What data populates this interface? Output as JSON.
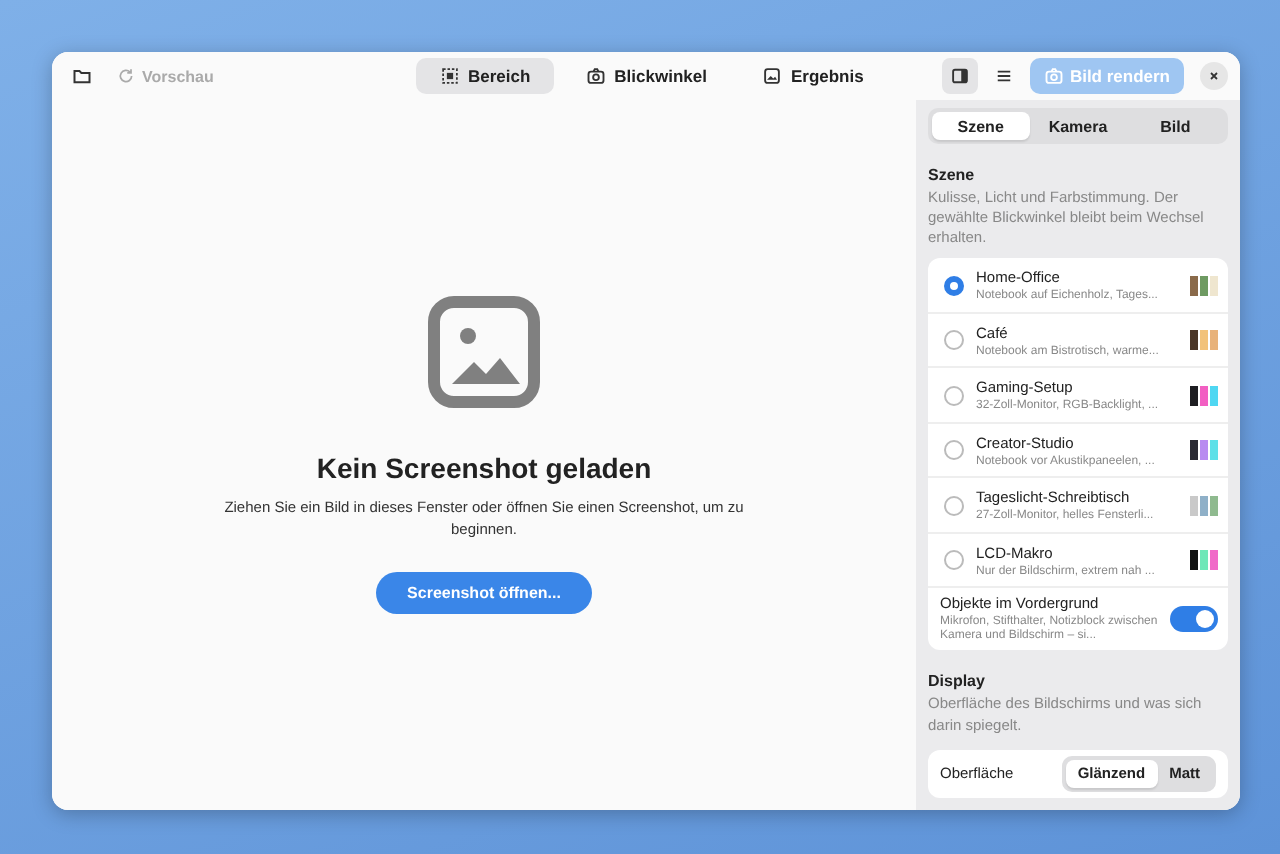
{
  "toolbar": {
    "preview": {
      "label": "Vorschau",
      "disabled": true
    },
    "tabs": [
      {
        "label": "Bereich",
        "selected": true
      },
      {
        "label": "Blickwinkel",
        "selected": false
      },
      {
        "label": "Ergebnis",
        "selected": false
      }
    ],
    "sidebar_toggle": {
      "on": true
    },
    "render_button": {
      "label": "Bild rendern",
      "disabled": true
    }
  },
  "empty_state": {
    "title": "Kein Screenshot geladen",
    "text": "Ziehen Sie ein Bild in dieses Fenster oder öffnen Sie einen Screenshot, um zu beginnen.",
    "button": "Screenshot öffnen..."
  },
  "sidebar": {
    "tabs": [
      {
        "label": "Szene",
        "selected": true
      },
      {
        "label": "Kamera",
        "selected": false
      },
      {
        "label": "Bild",
        "selected": false
      }
    ],
    "scene": {
      "heading": "Szene",
      "description": "Kulisse, Licht und Farbstimmung. Der gewählte Blickwinkel bleibt beim Wechsel erhalten.",
      "options": [
        {
          "name": "Home-Office",
          "detail": "Notebook auf Eichenholz, Tages...",
          "selected": true,
          "swatches": [
            {
              "color": "#8a6a4a"
            },
            {
              "color": "#6e9a62"
            },
            {
              "color": "#efe6cf"
            }
          ]
        },
        {
          "name": "Café",
          "detail": "Notebook am Bistrotisch, warme...",
          "selected": false,
          "swatches": [
            {
              "color": "#4a3628"
            },
            {
              "color": "#f2c27a"
            },
            {
              "color": "#e8b27a"
            }
          ]
        },
        {
          "name": "Gaming-Setup",
          "detail": "32-Zoll-Monitor, RGB-Backlight, ...",
          "selected": false,
          "swatches": [
            {
              "color": "#1e1e22"
            },
            {
              "color": "#f25fc2"
            },
            {
              "color": "#4fd7f2"
            }
          ]
        },
        {
          "name": "Creator-Studio",
          "detail": "Notebook vor Akustikpaneelen, ...",
          "selected": false,
          "swatches": [
            {
              "color": "#2a2a33"
            },
            {
              "color": "#b98af0"
            },
            {
              "color": "#5ee0e8"
            }
          ]
        },
        {
          "name": "Tageslicht-Schreibtisch",
          "detail": "27-Zoll-Monitor, helles Fensterli...",
          "selected": false,
          "swatches": [
            {
              "color": "#c9c9c9"
            },
            {
              "color": "#8fb0c8"
            },
            {
              "color": "#8fba8f"
            }
          ]
        },
        {
          "name": "LCD-Makro",
          "detail": "Nur der Bildschirm, extrem nah ...",
          "selected": false,
          "swatches": [
            {
              "color": "#111111"
            },
            {
              "color": "#6de8b8"
            },
            {
              "color": "#f06ac8"
            }
          ]
        }
      ],
      "foreground": {
        "label": "Objekte im Vordergrund",
        "detail": "Mikrofon, Stifthalter, Notizblock zwischen Kamera und Bildschirm – si...",
        "on": true
      }
    },
    "display": {
      "heading": "Display",
      "description": "Oberfläche des Bildschirms und was sich darin spiegelt.",
      "surface": {
        "label": "Oberfläche",
        "options": [
          {
            "label": "Glänzend",
            "selected": true
          },
          {
            "label": "Matt",
            "selected": false
          }
        ]
      }
    }
  }
}
